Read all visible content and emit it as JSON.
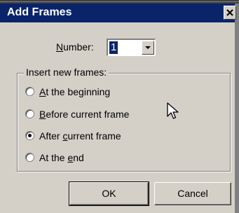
{
  "dialog": {
    "title": "Add Frames"
  },
  "number": {
    "label_mnemonic": "N",
    "label_rest": "umber:",
    "value": "1"
  },
  "insert_group": {
    "label": "Insert new frames:",
    "options": [
      {
        "pre": "",
        "key": "A",
        "post": "t the beginning",
        "checked": false
      },
      {
        "pre": "",
        "key": "B",
        "post": "efore current frame",
        "checked": false
      },
      {
        "pre": "After ",
        "key": "c",
        "post": "urrent frame",
        "checked": true
      },
      {
        "pre": "At the ",
        "key": "e",
        "post": "nd",
        "checked": false
      }
    ]
  },
  "buttons": {
    "ok": "OK",
    "cancel": "Cancel"
  },
  "icons": {
    "close": "close-icon",
    "dropdown": "chevron-down-icon",
    "cursor": "mouse-pointer-icon"
  }
}
